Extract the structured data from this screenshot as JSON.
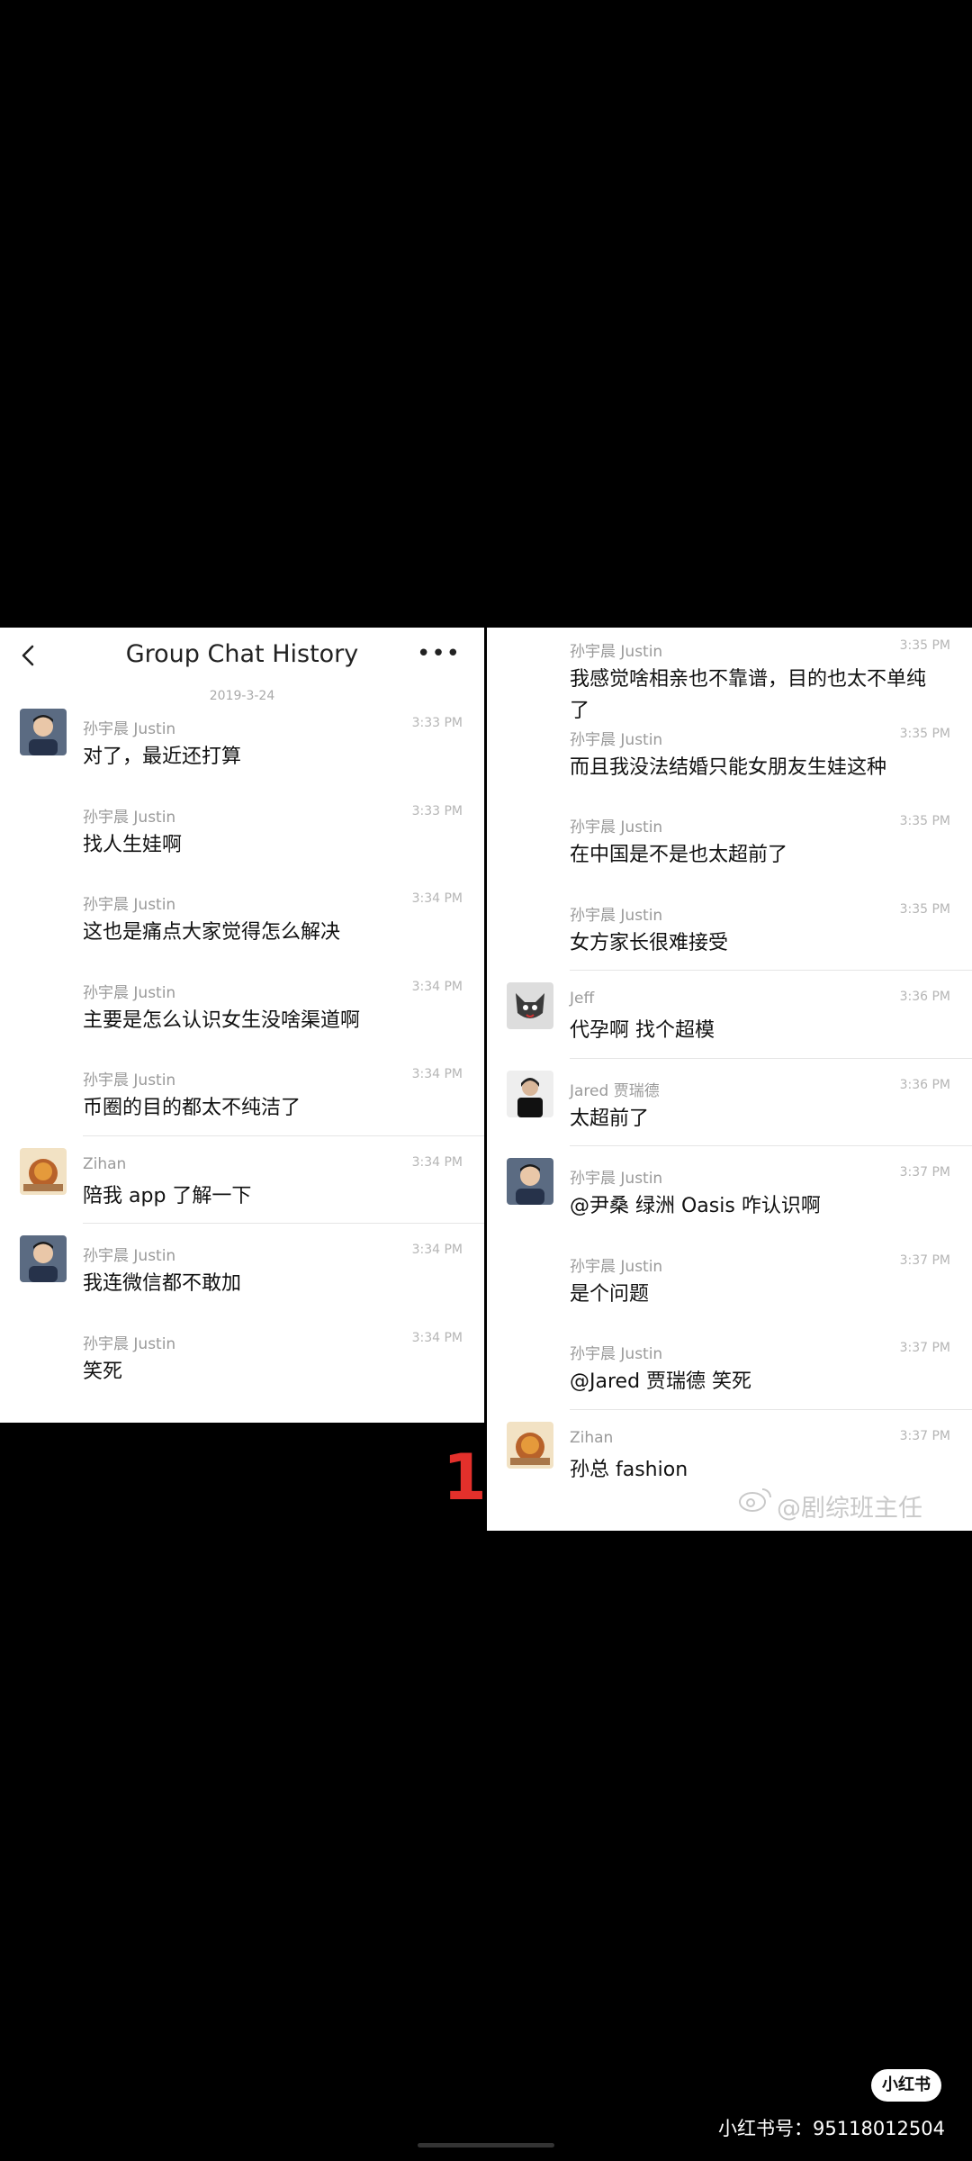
{
  "left_panel": {
    "title": "Group Chat History",
    "date": "2019-3-24",
    "messages": [
      {
        "sender": "孙宇晨 Justin",
        "time": "3:33 PM",
        "text": "对了，最近还打算",
        "avatar": "justin"
      },
      {
        "sender": "孙宇晨 Justin",
        "time": "3:33 PM",
        "text": "找人生娃啊",
        "avatar": ""
      },
      {
        "sender": "孙宇晨 Justin",
        "time": "3:34 PM",
        "text": "这也是痛点大家觉得怎么解决",
        "avatar": ""
      },
      {
        "sender": "孙宇晨 Justin",
        "time": "3:34 PM",
        "text": "主要是怎么认识女生没啥渠道啊",
        "avatar": ""
      },
      {
        "sender": "孙宇晨 Justin",
        "time": "3:34 PM",
        "text": "币圈的目的都太不纯洁了",
        "avatar": ""
      },
      {
        "sender": "Zihan",
        "time": "3:34 PM",
        "text": "陪我 app 了解一下",
        "avatar": "zihan"
      },
      {
        "sender": "孙宇晨 Justin",
        "time": "3:34 PM",
        "text": "我连微信都不敢加",
        "avatar": "justin"
      },
      {
        "sender": "孙宇晨 Justin",
        "time": "3:34 PM",
        "text": "笑死",
        "avatar": ""
      }
    ]
  },
  "right_panel": {
    "messages": [
      {
        "sender": "孙宇晨 Justin",
        "time": "3:35 PM",
        "text": "我感觉啥相亲也不靠谱，目的也太不单纯了",
        "avatar": ""
      },
      {
        "sender": "孙宇晨 Justin",
        "time": "3:35 PM",
        "text": "而且我没法结婚只能女朋友生娃这种",
        "avatar": ""
      },
      {
        "sender": "孙宇晨 Justin",
        "time": "3:35 PM",
        "text": "在中国是不是也太超前了",
        "avatar": ""
      },
      {
        "sender": "孙宇晨 Justin",
        "time": "3:35 PM",
        "text": "女方家长很难接受",
        "avatar": ""
      },
      {
        "sender": "Jeff",
        "time": "3:36 PM",
        "text": "代孕啊 找个超模",
        "avatar": "jeff"
      },
      {
        "sender": "Jared 贾瑞德",
        "time": "3:36 PM",
        "text": "太超前了",
        "avatar": "jared"
      },
      {
        "sender": "孙宇晨 Justin",
        "time": "3:37 PM",
        "text": "@尹桑 绿洲 Oasis 咋认识啊",
        "avatar": "justin"
      },
      {
        "sender": "孙宇晨 Justin",
        "time": "3:37 PM",
        "text": "是个问题",
        "avatar": ""
      },
      {
        "sender": "孙宇晨 Justin",
        "time": "3:37 PM",
        "text": "@Jared 贾瑞德 笑死",
        "avatar": ""
      },
      {
        "sender": "Zihan",
        "time": "3:37 PM",
        "text": "孙总 fashion",
        "avatar": "zihan"
      }
    ]
  },
  "overlay": {
    "mark": "1",
    "weibo_watermark": "@剧综班主任"
  },
  "footer": {
    "logo": "小红书",
    "id_text": "小红书号：95118012504"
  },
  "icons": {
    "back": "chevron-left-icon",
    "more": "more-options-icon",
    "weibo": "weibo-logo-icon"
  }
}
